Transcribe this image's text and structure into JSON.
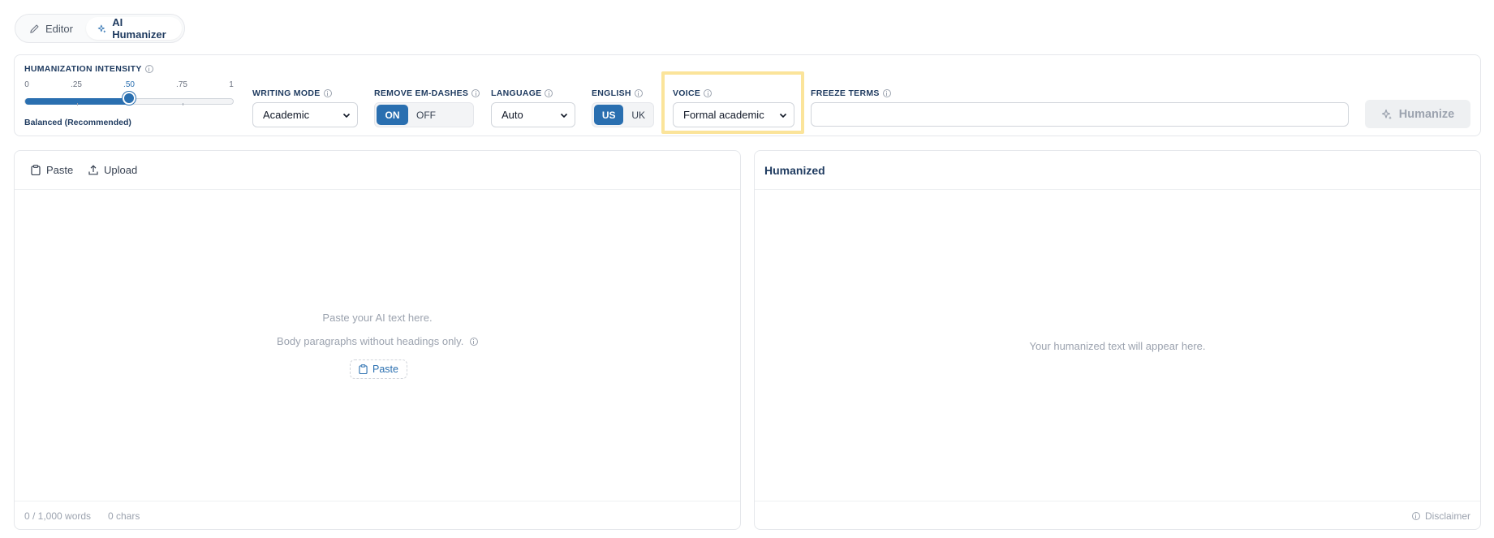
{
  "tabs": [
    {
      "label": "Editor",
      "icon": "pencil-icon",
      "active": false
    },
    {
      "label": "AI Humanizer",
      "icon": "sparkles-icon",
      "active": true
    }
  ],
  "controls": {
    "intensity": {
      "label": "HUMANIZATION INTENSITY",
      "ticks": [
        "0",
        ".25",
        ".50",
        ".75",
        "1"
      ],
      "value": 0.5,
      "caption": "Balanced (Recommended)"
    },
    "writing_mode": {
      "label": "WRITING MODE",
      "value": "Academic"
    },
    "remove_em_dashes": {
      "label": "REMOVE EM-DASHES",
      "on_label": "ON",
      "off_label": "OFF",
      "selected": "ON"
    },
    "language": {
      "label": "LANGUAGE",
      "value": "Auto"
    },
    "english": {
      "label": "ENGLISH",
      "options": [
        "US",
        "UK"
      ],
      "selected": "US"
    },
    "voice": {
      "label": "VOICE",
      "value": "Formal academic"
    },
    "freeze_terms": {
      "label": "FREEZE TERMS",
      "value": ""
    },
    "humanize_button": "Humanize"
  },
  "input_panel": {
    "paste_label": "Paste",
    "upload_label": "Upload",
    "empty_line1": "Paste your AI text here.",
    "empty_line2": "Body paragraphs without headings only.",
    "paste_chip_label": "Paste",
    "word_count": "0 / 1,000 words",
    "char_count": "0 chars"
  },
  "output_panel": {
    "title": "Humanized",
    "empty_text": "Your humanized text will appear here.",
    "disclaimer": "Disclaimer"
  },
  "colors": {
    "accent": "#2a6fb0",
    "heading": "#1e3a5f",
    "highlight": "#fbe49a",
    "muted": "#9ca3af"
  }
}
